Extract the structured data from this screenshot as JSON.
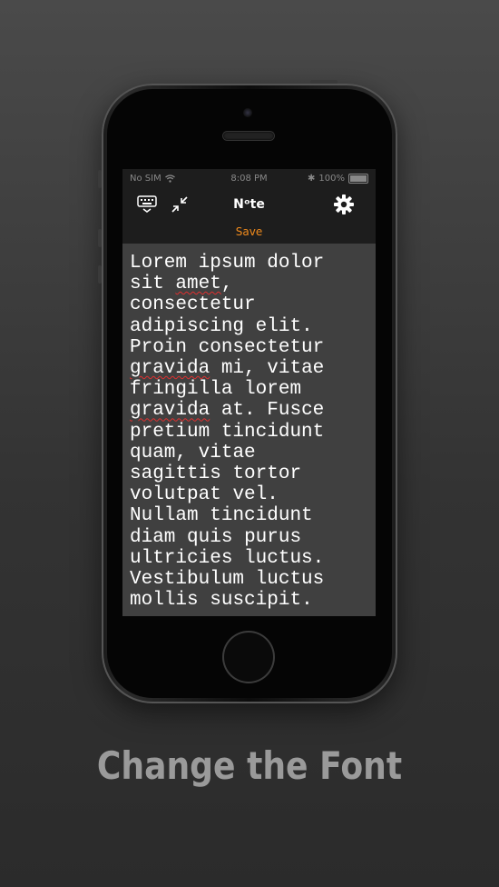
{
  "status_bar": {
    "carrier": "No SIM",
    "time": "8:08 PM",
    "battery_percent": "100%",
    "icons": [
      "wifi-icon",
      "bluetooth-icon",
      "battery-icon"
    ]
  },
  "nav": {
    "title": "Nᵒte",
    "left_icons": [
      "keyboard-dismiss-icon",
      "collapse-arrows-icon"
    ],
    "right_icon": "gear-icon"
  },
  "save_label": "Save",
  "editor": {
    "lines": [
      "Lorem ipsum dolor",
      "sit amet,",
      "consectetur",
      "adipiscing elit.",
      "Proin consectetur",
      "gravida mi, vitae",
      "fringilla lorem",
      "gravida at. Fusce",
      "pretium tincidunt",
      "quam, vitae",
      "sagittis tortor",
      "volutpat vel.",
      "Nullam tincidunt",
      "diam quis purus",
      "ultricies luctus.",
      "Vestibulum luctus",
      "mollis suscipit."
    ],
    "misspelled_words": [
      "amet",
      "gravida"
    ]
  },
  "caption": "Change the Font",
  "colors": {
    "accent": "#f08a1c",
    "editor_bg": "#404040",
    "caption": "#9a9a9a"
  }
}
